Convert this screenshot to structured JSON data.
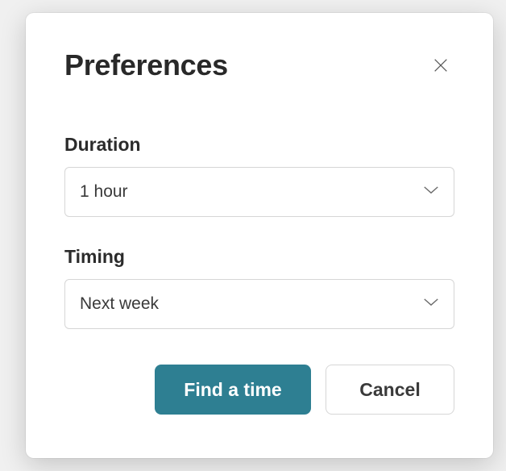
{
  "modal": {
    "title": "Preferences",
    "duration": {
      "label": "Duration",
      "value": "1 hour"
    },
    "timing": {
      "label": "Timing",
      "value": "Next week"
    },
    "buttons": {
      "primary": "Find a time",
      "secondary": "Cancel"
    }
  }
}
